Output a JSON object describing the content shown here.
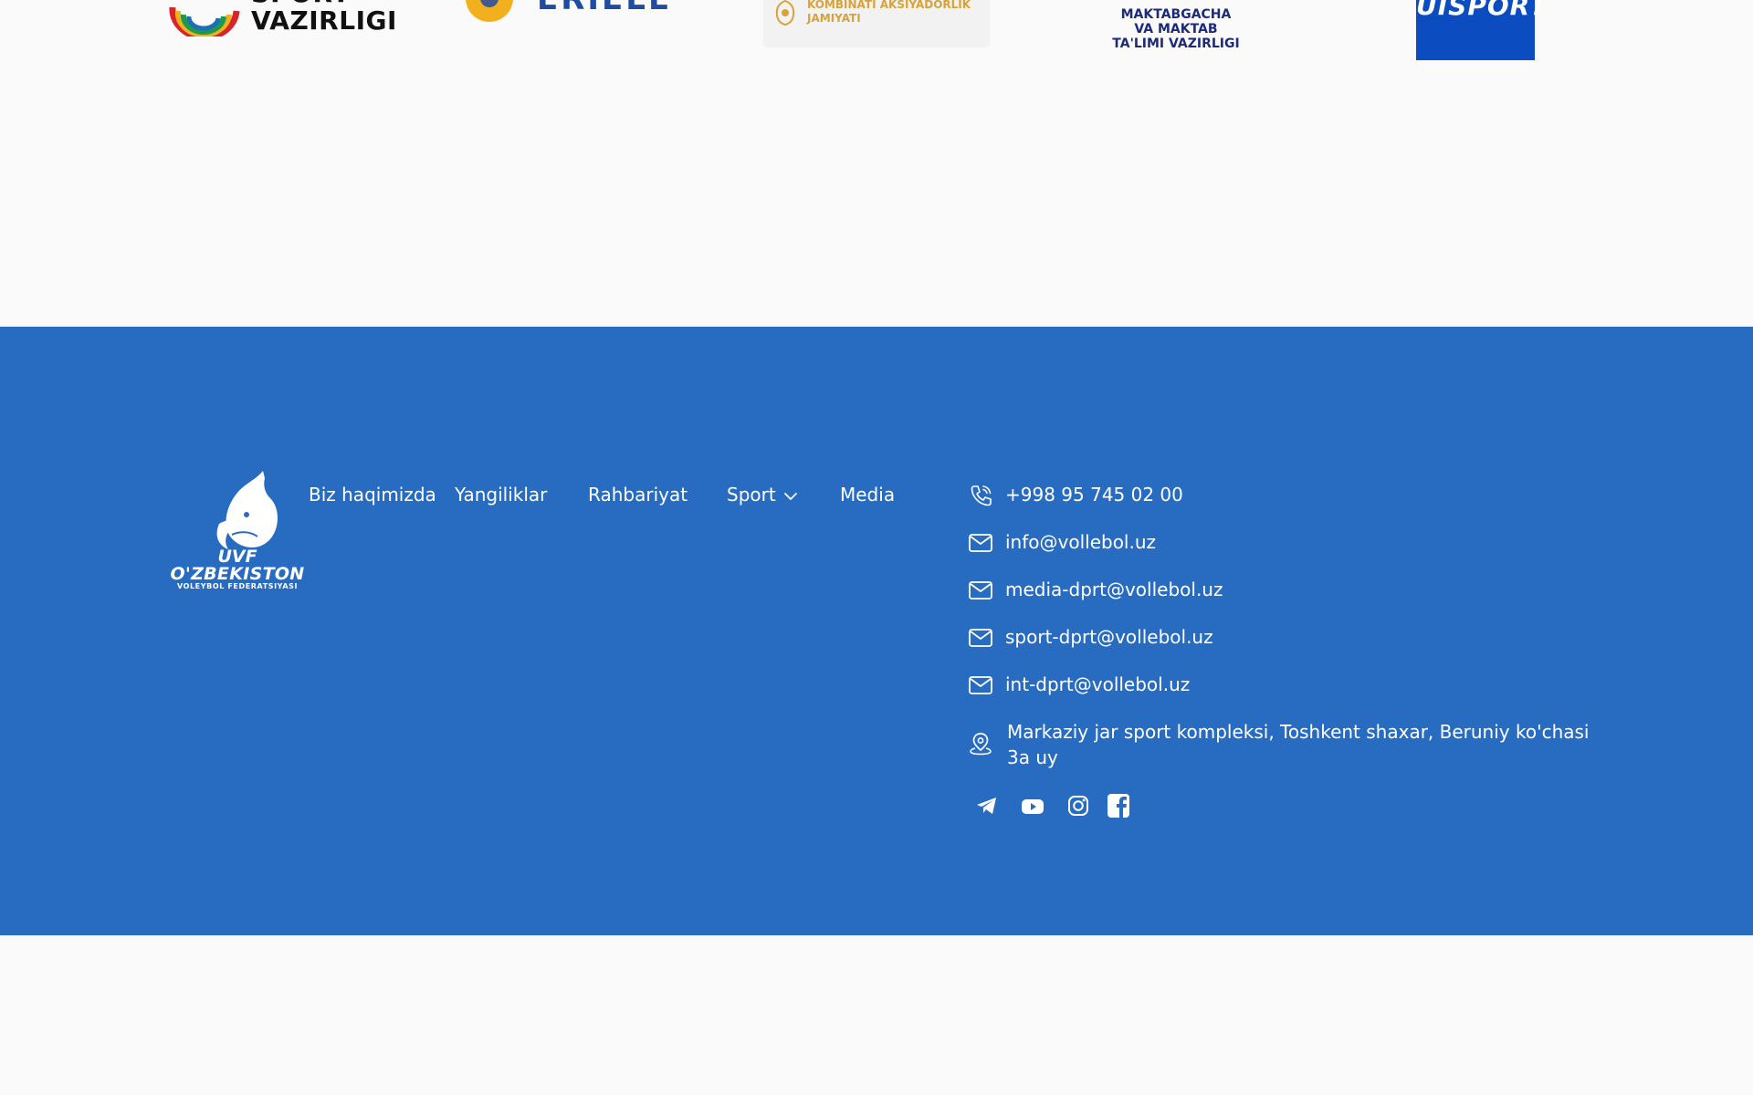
{
  "partners": {
    "sport_ministry": {
      "line1": "SPORT",
      "line2": "VAZIRLIGI"
    },
    "eriell": {
      "name": "ERIELL"
    },
    "combine": {
      "line1": "KOMBINATI AKSIYADORLIK",
      "line2": "JAMIYATI"
    },
    "maktab": {
      "line1": "MAKTABGACHA",
      "line2": "VA MAKTAB",
      "line3": "TA'LIMI VAZIRLIGI"
    },
    "uisport": {
      "name": "UISPORT"
    }
  },
  "footer": {
    "background": "#286cc2",
    "logo": {
      "abbr": "UVF",
      "country": "O'ZBEKISTON",
      "federation": "VOLEYBOL FEDERATSIYASI"
    },
    "nav": [
      {
        "label": "Biz haqimizda"
      },
      {
        "label": "Yangiliklar"
      },
      {
        "label": "Rahbariyat"
      },
      {
        "label": "Sport",
        "dropdown": true,
        "icon": "chevron-down-icon"
      },
      {
        "label": "Media"
      }
    ],
    "contacts": {
      "phone": {
        "icon": "phone-icon",
        "value": "+998 95 745 02 00"
      },
      "emails": [
        {
          "icon": "mail-icon",
          "value": "info@vollebol.uz"
        },
        {
          "icon": "mail-icon",
          "value": "media-dprt@vollebol.uz"
        },
        {
          "icon": "mail-icon",
          "value": "sport-dprt@vollebol.uz"
        },
        {
          "icon": "mail-icon",
          "value": "int-dprt@vollebol.uz"
        }
      ],
      "address": {
        "icon": "map-pin-icon",
        "value": "Markaziy jar sport kompleksi, Toshkent shaxar, Beruniy ko'chasi 3a uy"
      }
    },
    "socials": [
      {
        "name": "telegram-icon"
      },
      {
        "name": "youtube-icon"
      },
      {
        "name": "instagram-icon"
      },
      {
        "name": "facebook-icon"
      }
    ]
  }
}
